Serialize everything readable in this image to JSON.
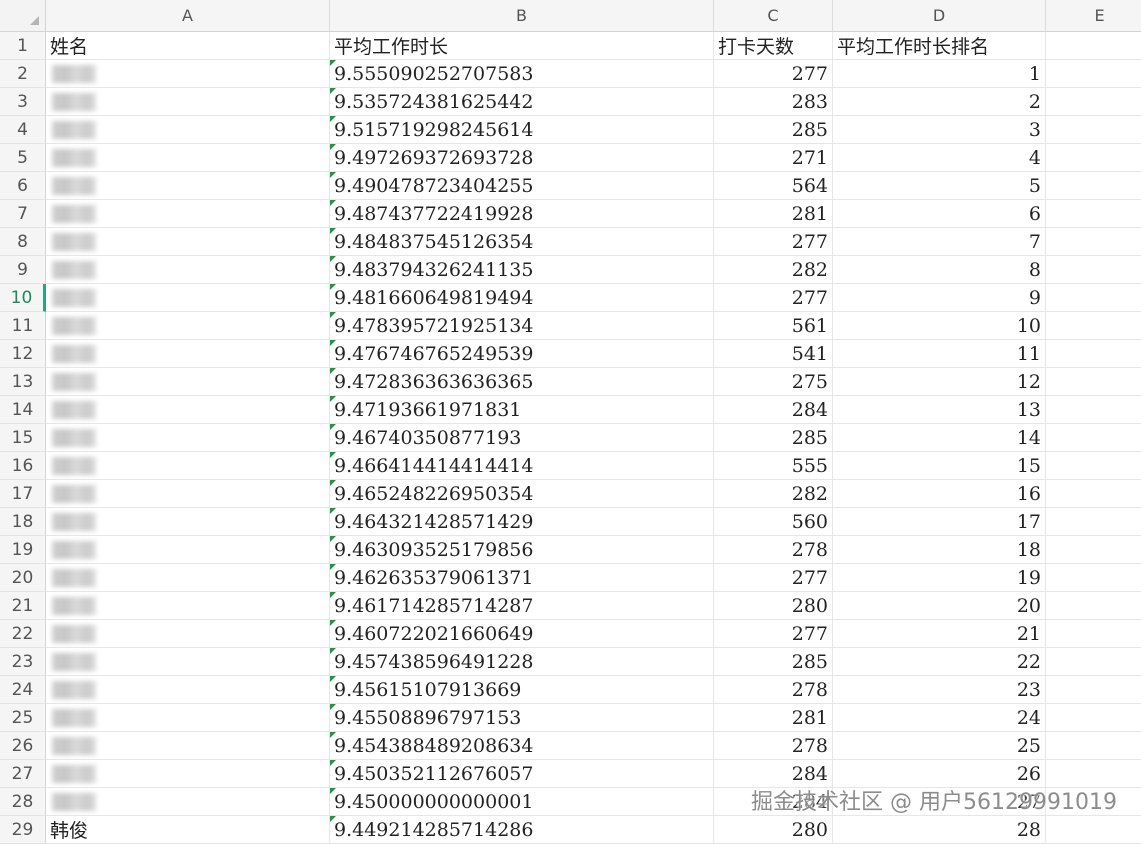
{
  "columns": [
    "A",
    "B",
    "C",
    "D",
    "E"
  ],
  "headers": {
    "name": "姓名",
    "avg_hours": "平均工作时长",
    "days": "打卡天数",
    "rank": "平均工作时长排名"
  },
  "active_row": 10,
  "name_hidden_note": "",
  "rows": [
    {
      "num": "2",
      "name": "",
      "avg": "9.555090252707583",
      "days": "277",
      "rank": "1"
    },
    {
      "num": "3",
      "name": "",
      "avg": "9.535724381625442",
      "days": "283",
      "rank": "2"
    },
    {
      "num": "4",
      "name": "",
      "avg": "9.515719298245614",
      "days": "285",
      "rank": "3"
    },
    {
      "num": "5",
      "name": "",
      "avg": "9.497269372693728",
      "days": "271",
      "rank": "4"
    },
    {
      "num": "6",
      "name": "",
      "avg": "9.490478723404255",
      "days": "564",
      "rank": "5"
    },
    {
      "num": "7",
      "name": "",
      "avg": "9.487437722419928",
      "days": "281",
      "rank": "6"
    },
    {
      "num": "8",
      "name": "",
      "avg": "9.484837545126354",
      "days": "277",
      "rank": "7"
    },
    {
      "num": "9",
      "name": "",
      "avg": "9.483794326241135",
      "days": "282",
      "rank": "8"
    },
    {
      "num": "10",
      "name": "",
      "avg": "9.481660649819494",
      "days": "277",
      "rank": "9"
    },
    {
      "num": "11",
      "name": "",
      "avg": "9.478395721925134",
      "days": "561",
      "rank": "10"
    },
    {
      "num": "12",
      "name": "",
      "avg": "9.476746765249539",
      "days": "541",
      "rank": "11"
    },
    {
      "num": "13",
      "name": "",
      "avg": "9.472836363636365",
      "days": "275",
      "rank": "12"
    },
    {
      "num": "14",
      "name": "",
      "avg": "9.47193661971831",
      "days": "284",
      "rank": "13"
    },
    {
      "num": "15",
      "name": "",
      "avg": "9.46740350877193",
      "days": "285",
      "rank": "14"
    },
    {
      "num": "16",
      "name": "",
      "avg": "9.466414414414414",
      "days": "555",
      "rank": "15"
    },
    {
      "num": "17",
      "name": "",
      "avg": "9.465248226950354",
      "days": "282",
      "rank": "16"
    },
    {
      "num": "18",
      "name": "",
      "avg": "9.464321428571429",
      "days": "560",
      "rank": "17"
    },
    {
      "num": "19",
      "name": "",
      "avg": "9.463093525179856",
      "days": "278",
      "rank": "18"
    },
    {
      "num": "20",
      "name": "",
      "avg": "9.462635379061371",
      "days": "277",
      "rank": "19"
    },
    {
      "num": "21",
      "name": "",
      "avg": "9.461714285714287",
      "days": "280",
      "rank": "20"
    },
    {
      "num": "22",
      "name": "",
      "avg": "9.460722021660649",
      "days": "277",
      "rank": "21"
    },
    {
      "num": "23",
      "name": "",
      "avg": "9.457438596491228",
      "days": "285",
      "rank": "22"
    },
    {
      "num": "24",
      "name": "",
      "avg": "9.45615107913669",
      "days": "278",
      "rank": "23"
    },
    {
      "num": "25",
      "name": "",
      "avg": "9.45508896797153",
      "days": "281",
      "rank": "24"
    },
    {
      "num": "26",
      "name": "",
      "avg": "9.454388489208634",
      "days": "278",
      "rank": "25"
    },
    {
      "num": "27",
      "name": "",
      "avg": "9.450352112676057",
      "days": "284",
      "rank": "26"
    },
    {
      "num": "28",
      "name": "",
      "avg": "9.450000000000001",
      "days": "284",
      "rank": "27"
    },
    {
      "num": "29",
      "name": "韩俊",
      "avg": "9.449214285714286",
      "days": "280",
      "rank": "28"
    }
  ],
  "watermark": "掘金技术社区 @ 用户56129991019"
}
